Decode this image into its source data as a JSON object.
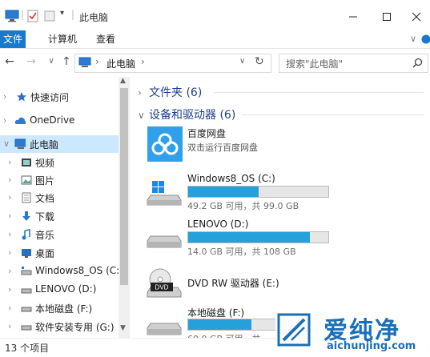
{
  "window": {
    "title": "此电脑",
    "minimize_icon": "minimize-icon",
    "maximize_icon": "maximize-icon",
    "close_icon": "close-icon"
  },
  "ribbon": {
    "tabs": [
      {
        "label": "文件",
        "active": true
      },
      {
        "label": "计算机"
      },
      {
        "label": "查看"
      }
    ]
  },
  "address": {
    "crumb": "此电脑",
    "search_placeholder": "搜索\"此电脑\""
  },
  "sidebar": {
    "items": [
      {
        "label": "快速访问",
        "icon": "star-icon"
      },
      {
        "label": "OneDrive",
        "icon": "cloud-icon"
      },
      {
        "label": "此电脑",
        "icon": "computer-icon",
        "selected": true
      },
      {
        "label": "视频",
        "icon": "video-icon"
      },
      {
        "label": "图片",
        "icon": "picture-icon"
      },
      {
        "label": "文档",
        "icon": "document-icon"
      },
      {
        "label": "下载",
        "icon": "download-icon"
      },
      {
        "label": "音乐",
        "icon": "music-icon"
      },
      {
        "label": "桌面",
        "icon": "desktop-icon"
      },
      {
        "label": "Windows8_OS (C:)",
        "icon": "drive-icon"
      },
      {
        "label": "LENOVO (D:)",
        "icon": "drive-icon"
      },
      {
        "label": "本地磁盘 (F:)",
        "icon": "drive-icon"
      },
      {
        "label": "软件安装专用 (G:)",
        "icon": "drive-icon"
      }
    ]
  },
  "main": {
    "groups": [
      {
        "label": "文件夹 (6)",
        "expanded": false
      },
      {
        "label": "设备和驱动器 (6)",
        "expanded": true
      }
    ],
    "drives": [
      {
        "name": "百度网盘",
        "sub": "双击运行百度网盘",
        "icon": "baidu-netdisk-icon"
      },
      {
        "name": "Windows8_OS (C:)",
        "size": "49.2 GB 可用，共 99.0 GB",
        "used_fraction": 0.503,
        "icon": "windows-drive-icon"
      },
      {
        "name": "LENOVO (D:)",
        "size": "14.0 GB 可用，共 108 GB",
        "used_fraction": 0.87,
        "icon": "hard-drive-icon"
      },
      {
        "name": "DVD RW 驱动器 (E:)",
        "icon": "dvd-drive-icon"
      },
      {
        "name": "本地磁盘 (F:)",
        "size": "60.0 GB 可用，共 ...",
        "used_fraction": 0.45,
        "icon": "hard-drive-icon"
      }
    ]
  },
  "status": {
    "items_count": "13 个项目"
  },
  "watermark": {
    "brand": "爱纯净",
    "url": "aichunjing.com"
  },
  "colors": {
    "accent": "#1979ca",
    "selected_bg": "#cce8ff",
    "progress": "#26a0da",
    "group_header": "#1e3f8a"
  }
}
